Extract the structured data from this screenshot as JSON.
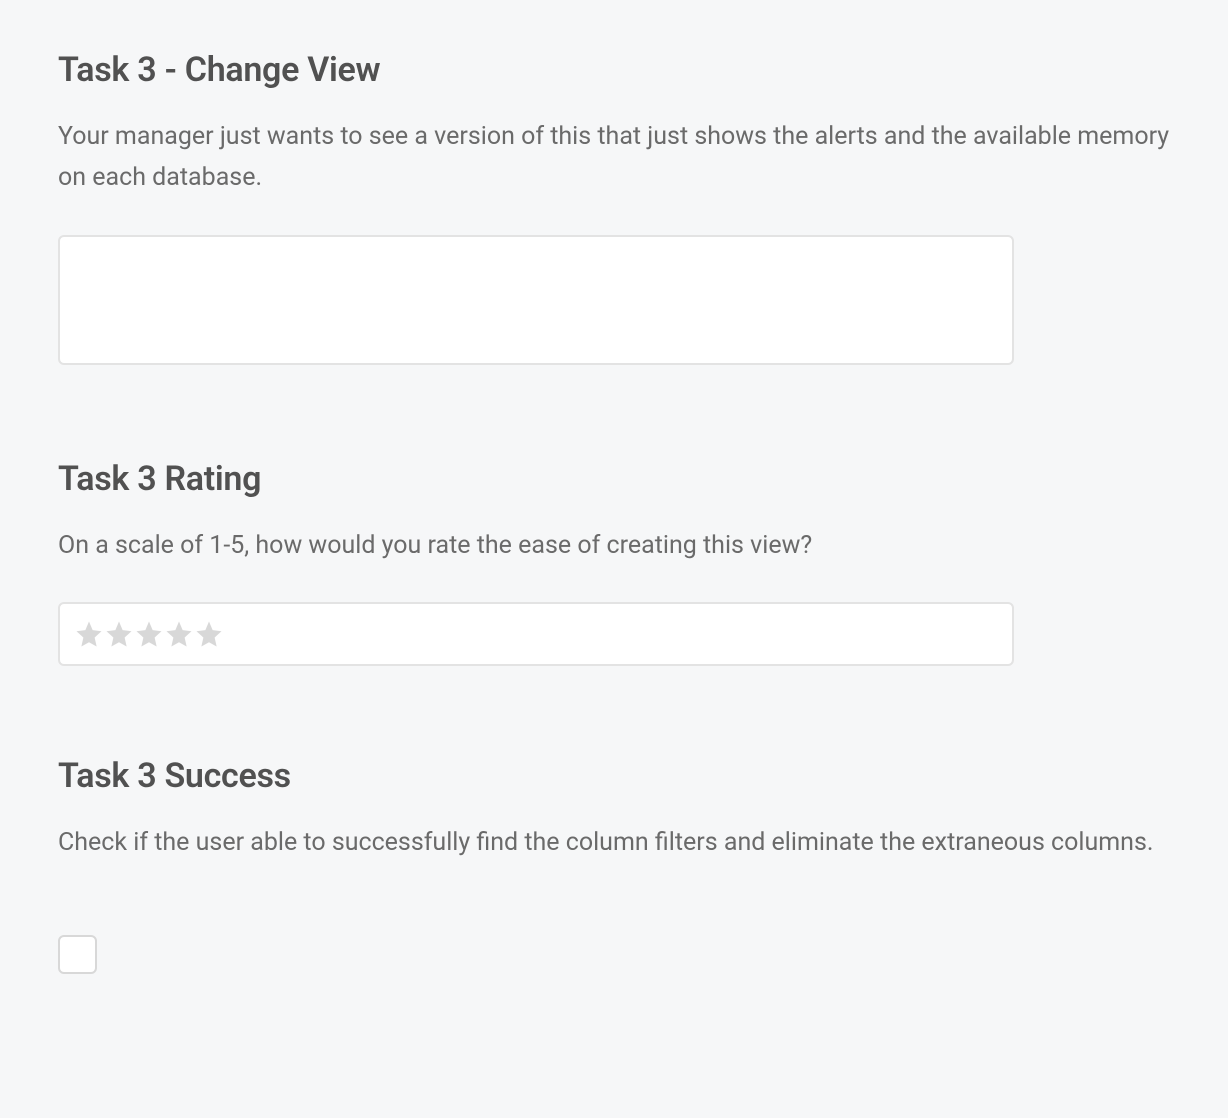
{
  "sections": {
    "changeView": {
      "heading": "Task 3 - Change View",
      "description": "Your manager just wants to see a version of this that just shows the alerts and the available memory on each database."
    },
    "rating": {
      "heading": "Task 3 Rating",
      "description": "On a scale of 1-5, how would you rate the ease of creating this view?",
      "starCount": 5
    },
    "success": {
      "heading": "Task 3 Success",
      "description": "Check if the user able to successfully find the column filters and eliminate the extraneous columns."
    }
  }
}
